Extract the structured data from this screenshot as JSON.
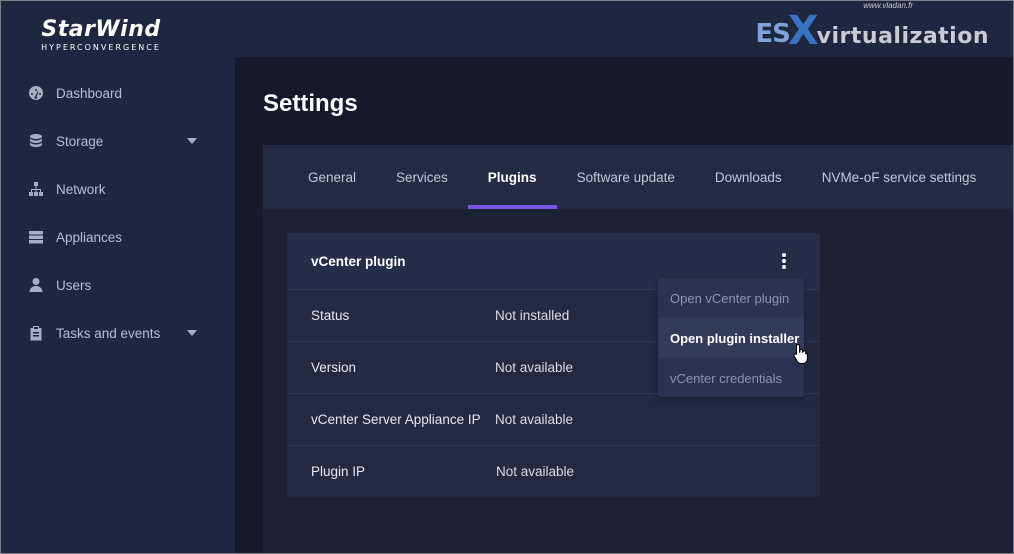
{
  "sidebar": {
    "logo_main": "StarWind",
    "logo_sub": "HYPERCONVERGENCE",
    "items": [
      {
        "label": "Dashboard",
        "icon": "dashboard-icon"
      },
      {
        "label": "Storage",
        "icon": "database-icon",
        "has_caret": true
      },
      {
        "label": "Network",
        "icon": "network-icon"
      },
      {
        "label": "Appliances",
        "icon": "server-icon"
      },
      {
        "label": "Users",
        "icon": "user-icon"
      },
      {
        "label": "Tasks and events",
        "icon": "clipboard-icon",
        "has_caret": true
      }
    ]
  },
  "watermark": {
    "es": "ES",
    "x": "X",
    "rest": "virtualization",
    "url": "www.vladan.fr"
  },
  "page": {
    "title": "Settings"
  },
  "tabs": [
    {
      "label": "General",
      "active": false
    },
    {
      "label": "Services",
      "active": false
    },
    {
      "label": "Plugins",
      "active": true
    },
    {
      "label": "Software update",
      "active": false
    },
    {
      "label": "Downloads",
      "active": false
    },
    {
      "label": "NVMe-oF service settings",
      "active": false
    }
  ],
  "plugin": {
    "title": "vCenter plugin",
    "rows": [
      {
        "label": "Status",
        "value": "Not installed"
      },
      {
        "label": "Version",
        "value": "Not available"
      },
      {
        "label": "vCenter Server Appliance IP",
        "value": "Not available"
      },
      {
        "label": "Plugin IP",
        "value": "Not available"
      }
    ]
  },
  "menu": {
    "items": [
      {
        "label": "Open vCenter plugin",
        "highlighted": false
      },
      {
        "label": "Open plugin installer",
        "highlighted": true
      },
      {
        "label": "vCenter credentials",
        "highlighted": false
      }
    ]
  },
  "colors": {
    "accent": "#7b54e8",
    "sidebar_bg": "#1e2740",
    "page_bg": "#141a2c"
  }
}
